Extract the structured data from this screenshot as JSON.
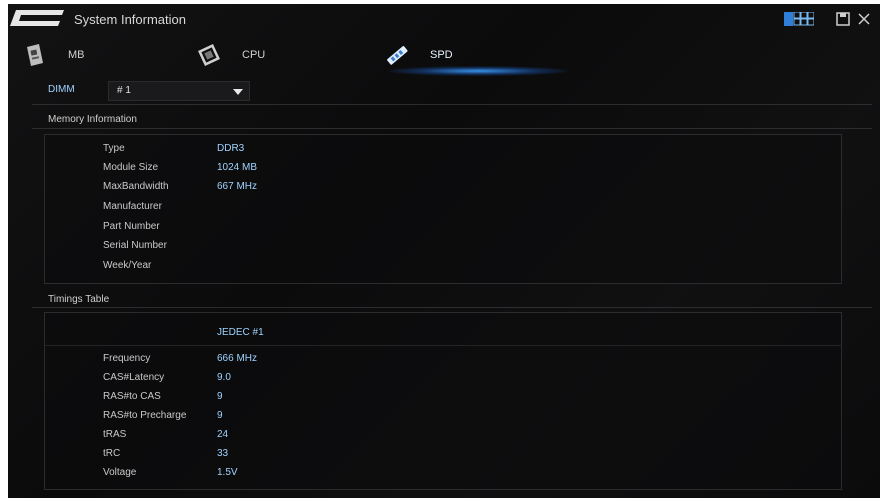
{
  "titlebar": {
    "logo_text": "ASUS",
    "title": "System Information",
    "controls": [
      "grid-icon",
      "save-icon",
      "close-icon"
    ]
  },
  "tabs": [
    {
      "label": "MB",
      "icon": "motherboard-icon"
    },
    {
      "label": "CPU",
      "icon": "cpu-chip-icon"
    },
    {
      "label": "SPD",
      "icon": "memory-stick-icon",
      "selected": true
    }
  ],
  "dimm": {
    "label": "DIMM",
    "value": "# 1"
  },
  "memory_info": {
    "title": "Memory Information",
    "rows": [
      {
        "key": "Type",
        "value": "DDR3"
      },
      {
        "key": "Module Size",
        "value": "1024 MB"
      },
      {
        "key": "MaxBandwidth",
        "value": "667 MHz"
      },
      {
        "key": "Manufacturer",
        "value": ""
      },
      {
        "key": "Part Number",
        "value": ""
      },
      {
        "key": "Serial Number",
        "value": ""
      },
      {
        "key": "Week/Year",
        "value": ""
      }
    ]
  },
  "timings": {
    "title": "Timings Table",
    "column_header": "JEDEC #1",
    "rows": [
      {
        "key": "Frequency",
        "value": "666 MHz"
      },
      {
        "key": "CAS#Latency",
        "value": "9.0"
      },
      {
        "key": "RAS#to CAS",
        "value": "9"
      },
      {
        "key": "RAS#to Precharge",
        "value": "9"
      },
      {
        "key": "tRAS",
        "value": "24"
      },
      {
        "key": "tRC",
        "value": "33"
      },
      {
        "key": "Voltage",
        "value": "1.5V"
      }
    ]
  },
  "colors": {
    "accent": "#9fd3ff",
    "background": "#0b0b0c",
    "tab_glow": "#3ca0ff"
  }
}
